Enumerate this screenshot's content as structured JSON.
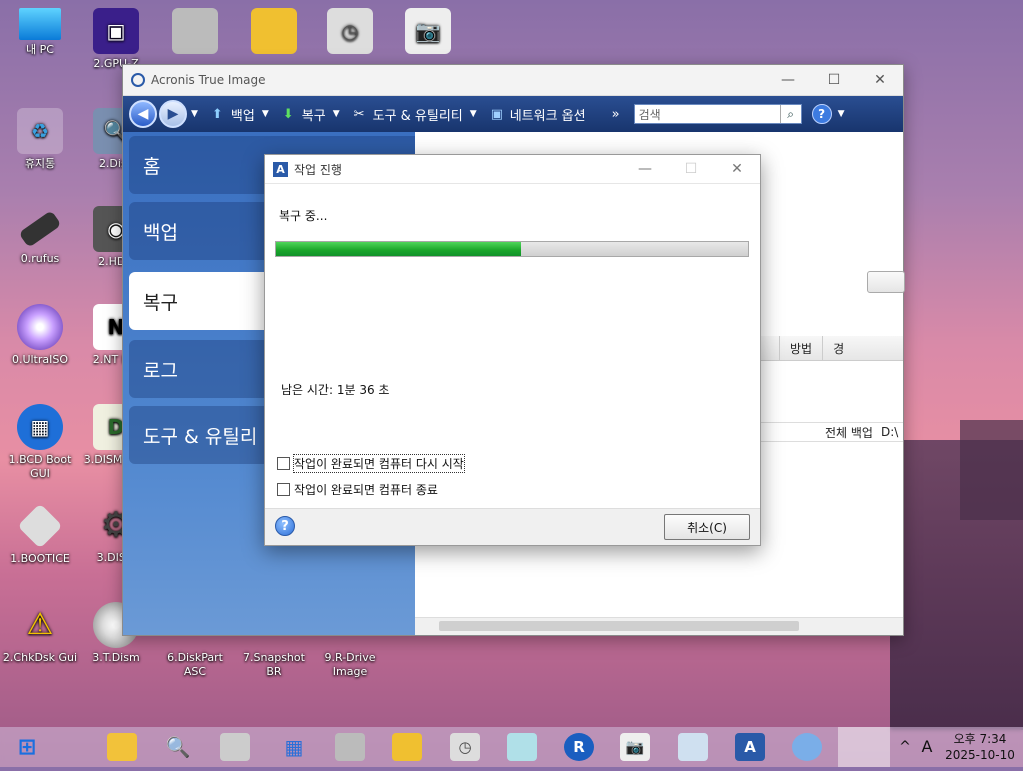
{
  "desktop": {
    "icons": [
      {
        "label": "내 PC"
      },
      {
        "label": "2.GPU-Z"
      },
      {
        "label": "휴지통"
      },
      {
        "label": "2.Disk"
      },
      {
        "label": "0.rufus"
      },
      {
        "label": "2.HDD"
      },
      {
        "label": "0.UltraISO"
      },
      {
        "label": "2.NT PW"
      },
      {
        "label": "1.BCD Boot GUI"
      },
      {
        "label": "3.DISM One"
      },
      {
        "label": "1.BOOTICE"
      },
      {
        "label": "3.DISM"
      },
      {
        "label": "2.ChkDsk Gui"
      },
      {
        "label": "3.T.Dism"
      },
      {
        "label": "6.DiskPart ASC"
      },
      {
        "label": "7.Snapshot BR"
      },
      {
        "label": "9.R-Drive Image"
      }
    ]
  },
  "acronis": {
    "title": "Acronis True Image",
    "toolbar": {
      "backup": "백업",
      "restore": "복구",
      "tools": "도구 & 유틸리티",
      "network": "네트워크 옵션",
      "more": "»",
      "search_placeholder": "검색",
      "help": "?"
    },
    "sidebar": {
      "home": "홈",
      "backup": "백업",
      "restore": "복구",
      "log": "로그",
      "tools": "도구 & 유틸리"
    },
    "table": {
      "col_method": "방법",
      "col_next": "경",
      "row_method": "전체 백업",
      "row_next": "D:\\"
    }
  },
  "dialog": {
    "title": "작업 진행",
    "status": "복구 중...",
    "progress": 0.52,
    "remaining": "남은 시간: 1분 36 초",
    "check_restart": "작업이 완료되면 컴퓨터 다시 시작",
    "check_shutdown": "작업이 완료되면 컴퓨터 종료",
    "cancel": "취소(C)",
    "help": "?"
  },
  "taskbar": {
    "clock_top": "오후 7:34",
    "clock_date": "2025-10-10",
    "ime": "A",
    "chevron": "^"
  },
  "colors": {
    "progress_green": "#1aa52a",
    "toolbar_blue": "#18356e",
    "sidebar_blue": "#3a6fc0"
  }
}
